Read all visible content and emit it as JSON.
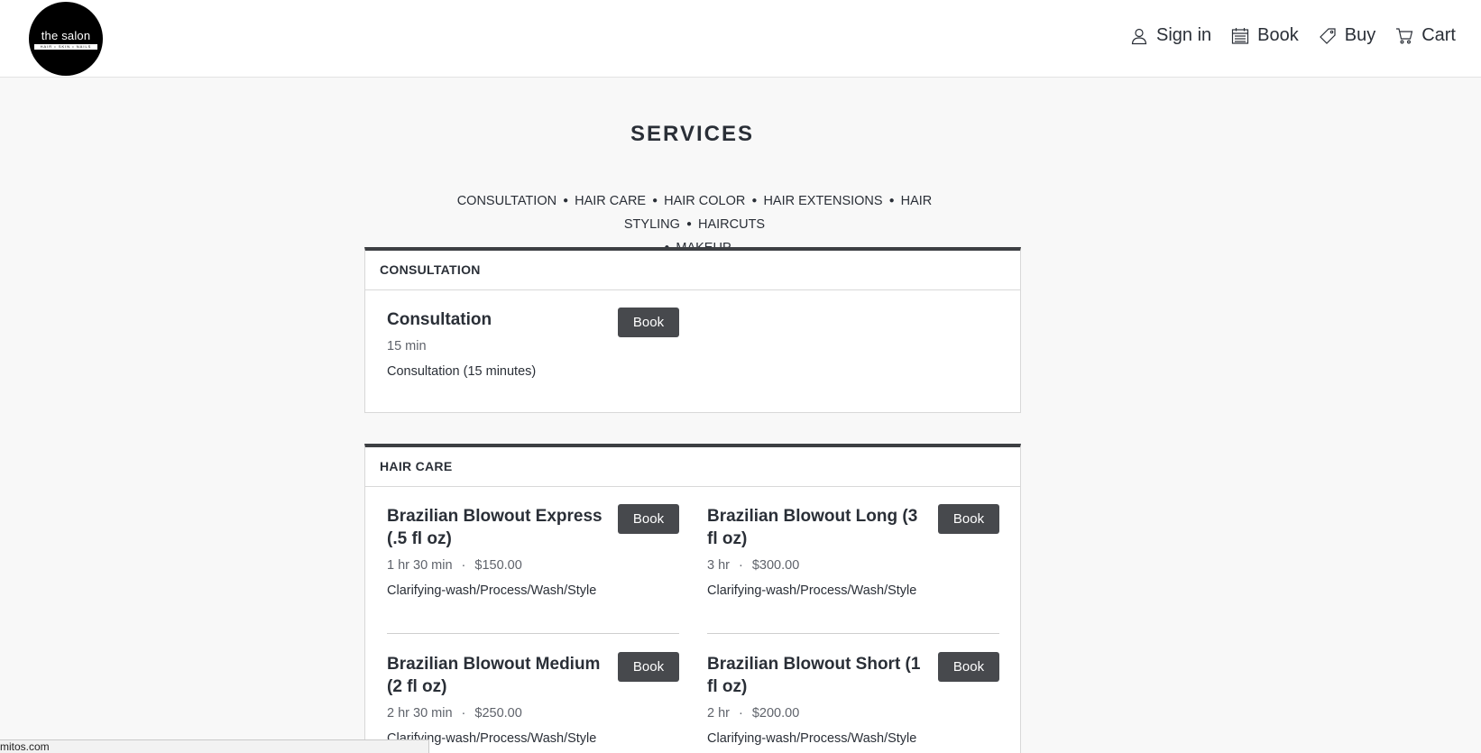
{
  "header": {
    "logo": {
      "name": "the salon",
      "tagline": "HAIR • SKIN • NAILS"
    },
    "nav": [
      {
        "label": "Sign in",
        "icon": "user-icon"
      },
      {
        "label": "Book",
        "icon": "calendar-icon"
      },
      {
        "label": "Buy",
        "icon": "tag-icon"
      },
      {
        "label": "Cart",
        "icon": "cart-icon"
      }
    ]
  },
  "page": {
    "title": "SERVICES"
  },
  "categories": [
    "CONSULTATION",
    "HAIR CARE",
    "HAIR COLOR",
    "HAIR EXTENSIONS",
    "HAIR STYLING",
    "HAIRCUTS",
    "MAKEUP"
  ],
  "sections": [
    {
      "title": "CONSULTATION",
      "services": [
        {
          "name": "Consultation",
          "duration": "15 min",
          "price": "",
          "description": "Consultation (15 minutes)",
          "button": "Book"
        }
      ]
    },
    {
      "title": "HAIR CARE",
      "services": [
        {
          "name": "Brazilian Blowout Express (.5 fl oz)",
          "duration": "1 hr 30 min",
          "price": "$150.00",
          "description": "Clarifying-wash/Process/Wash/Style",
          "button": "Book"
        },
        {
          "name": "Brazilian Blowout Long (3 fl oz)",
          "duration": "3 hr",
          "price": "$300.00",
          "description": "Clarifying-wash/Process/Wash/Style",
          "button": "Book"
        },
        {
          "name": "Brazilian Blowout Medium (2 fl oz)",
          "duration": "2 hr 30 min",
          "price": "$250.00",
          "description": "Clarifying-wash/Process/Wash/Style",
          "button": "Book"
        },
        {
          "name": "Brazilian Blowout Short (1 fl oz)",
          "duration": "2 hr",
          "price": "$200.00",
          "description": "Clarifying-wash/Process/Wash/Style",
          "button": "Book"
        }
      ]
    }
  ],
  "statusbar": {
    "url": "mitos.com"
  },
  "colors": {
    "button_bg": "#47494d",
    "section_top_border": "#3d3f43",
    "page_bg": "#f8f8f8"
  }
}
